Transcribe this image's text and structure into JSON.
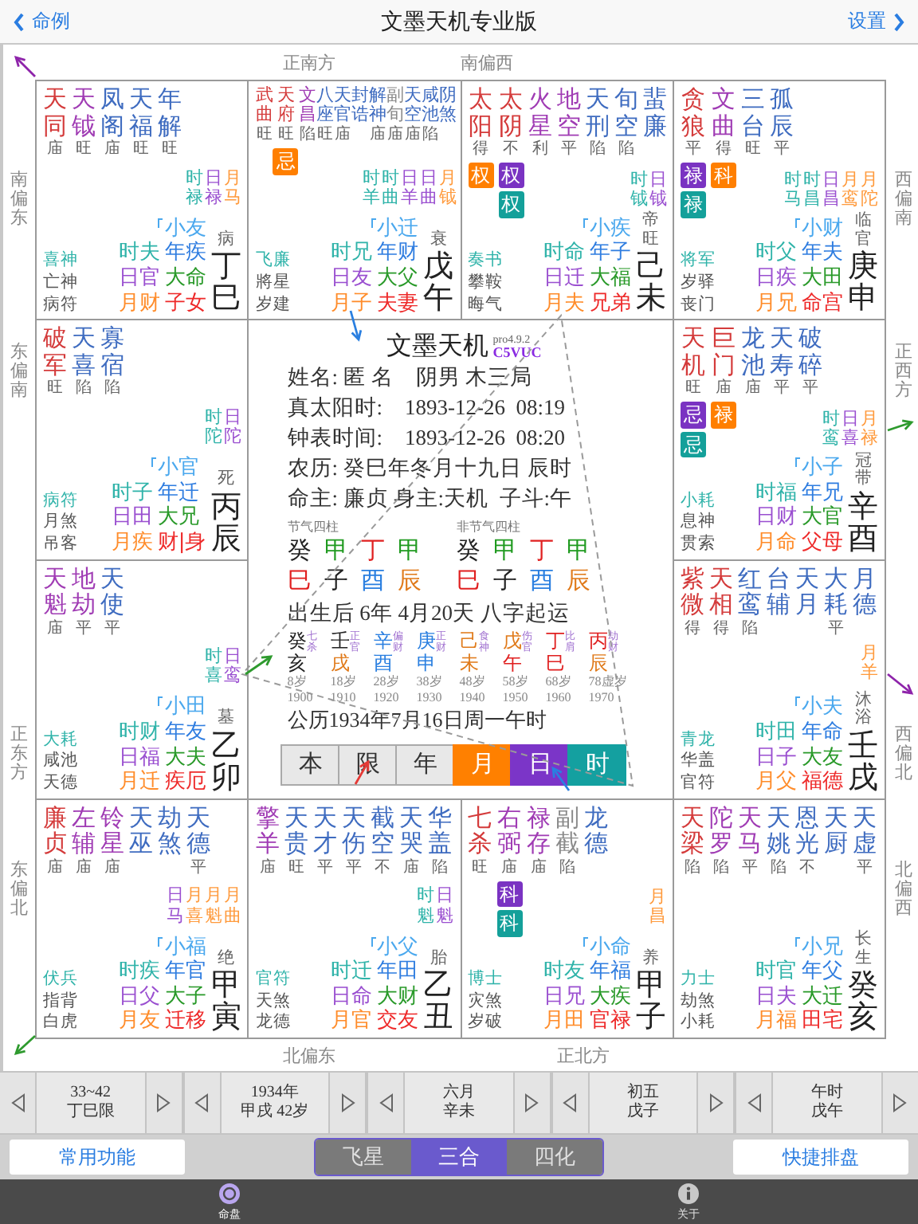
{
  "nav": {
    "back": "命例",
    "title": "文墨天机专业版",
    "settings": "设置"
  },
  "chart": {
    "directions": {
      "top": [
        "正南方",
        "南偏西"
      ],
      "left": [
        "南偏东",
        "东偏南",
        "正东方",
        "东偏北"
      ],
      "right": [
        "西偏南",
        "正西方",
        "西偏北",
        "北偏西"
      ],
      "bottom": [
        "北偏东",
        "正北方"
      ]
    },
    "palaces": [
      {
        "stars": [
          {
            "name": "天同",
            "brightness": "庙",
            "color": "#d43b3b"
          },
          {
            "name": "天钺",
            "brightness": "旺",
            "color": "#a03cb4"
          },
          {
            "name": "凤阁",
            "brightness": "庙",
            "color": "#3f6cc0"
          },
          {
            "name": "天福",
            "brightness": "旺",
            "color": "#3f6cc0"
          },
          {
            "name": "年解",
            "brightness": "旺",
            "color": "#3f6cc0"
          }
        ],
        "minor": [
          {
            "text": "时禄",
            "color": "#2fb3a9"
          },
          {
            "text": "日禄",
            "color": "#9a4fd0"
          },
          {
            "text": "月马",
            "color": "#ff9a3c"
          }
        ],
        "gods": [
          "喜神",
          "亡神",
          "病符"
        ],
        "times": [
          "时夫",
          "日官",
          "月财"
        ],
        "palaces": [
          "小友",
          "年疾",
          "大命",
          "子女"
        ],
        "stage": "病",
        "ganzhi": "丁巳"
      },
      {
        "stars": [
          {
            "name": "武曲",
            "brightness": "旺",
            "color": "#d43b3b"
          },
          {
            "name": "天府",
            "brightness": "旺",
            "color": "#d43b3b",
            "badges": [
              {
                "text": "忌",
                "color": "#ff7f00"
              }
            ]
          },
          {
            "name": "文昌",
            "brightness": "陷",
            "color": "#a03cb4"
          },
          {
            "name": "八座",
            "brightness": "旺",
            "color": "#3f6cc0"
          },
          {
            "name": "天官",
            "brightness": "庙",
            "color": "#3f6cc0"
          },
          {
            "name": "封诰",
            "color": "#3f6cc0"
          },
          {
            "name": "解神",
            "brightness": "庙",
            "color": "#3f6cc0"
          },
          {
            "name": "副旬",
            "brightness": "庙",
            "color": "#8a8a8a"
          },
          {
            "name": "天空",
            "brightness": "庙",
            "color": "#3f6cc0"
          },
          {
            "name": "咸池",
            "brightness": "陷",
            "color": "#3f6cc0"
          },
          {
            "name": "阴煞",
            "color": "#3f6cc0"
          }
        ],
        "minor": [
          {
            "text": "时羊",
            "color": "#2fb3a9"
          },
          {
            "text": "时曲",
            "color": "#2fb3a9"
          },
          {
            "text": "日羊",
            "color": "#9a4fd0"
          },
          {
            "text": "日曲",
            "color": "#9a4fd0"
          },
          {
            "text": "月钺",
            "color": "#ff9a3c"
          }
        ],
        "gods": [
          "飞廉",
          "將星",
          "岁建"
        ],
        "times": [
          "时兄",
          "日友",
          "月子"
        ],
        "palaces": [
          "小迁",
          "年财",
          "大父",
          "夫妻"
        ],
        "stage": "衰",
        "ganzhi": "戊午"
      },
      {
        "stars": [
          {
            "name": "太阳",
            "brightness": "得",
            "color": "#d43b3b",
            "badges": [
              {
                "text": "权",
                "color": "#ff7f00"
              }
            ]
          },
          {
            "name": "太阴",
            "brightness": "不",
            "color": "#d43b3b",
            "badges": [
              {
                "text": "权",
                "color": "#7a33c2"
              },
              {
                "text": "权",
                "color": "#14a09a"
              }
            ]
          },
          {
            "name": "火星",
            "brightness": "利",
            "color": "#a03cb4"
          },
          {
            "name": "地空",
            "brightness": "平",
            "color": "#a03cb4"
          },
          {
            "name": "天刑",
            "brightness": "陷",
            "color": "#3f6cc0"
          },
          {
            "name": "旬空",
            "brightness": "陷",
            "color": "#3f6cc0"
          },
          {
            "name": "蜚廉",
            "color": "#3f6cc0"
          }
        ],
        "minor": [
          {
            "text": "时钺",
            "color": "#2fb3a9"
          },
          {
            "text": "日钺",
            "color": "#9a4fd0"
          }
        ],
        "gods": [
          "奏书",
          "攀鞍",
          "晦气"
        ],
        "times": [
          "时命",
          "日迁",
          "月夫"
        ],
        "palaces": [
          "小疾",
          "年子",
          "大福",
          "兄弟"
        ],
        "stage": "帝旺",
        "ganzhi": "己未"
      },
      {
        "stars": [
          {
            "name": "贪狼",
            "brightness": "平",
            "color": "#d43b3b",
            "badges": [
              {
                "text": "禄",
                "color": "#7a33c2"
              },
              {
                "text": "禄",
                "color": "#14a09a"
              }
            ]
          },
          {
            "name": "文曲",
            "brightness": "得",
            "color": "#a03cb4",
            "badges": [
              {
                "text": "科",
                "color": "#ff7f00"
              }
            ]
          },
          {
            "name": "三台",
            "brightness": "旺",
            "color": "#3f6cc0"
          },
          {
            "name": "孤辰",
            "brightness": "平",
            "color": "#3f6cc0"
          }
        ],
        "minor": [
          {
            "text": "时马",
            "color": "#2fb3a9"
          },
          {
            "text": "时昌",
            "color": "#2fb3a9"
          },
          {
            "text": "日昌",
            "color": "#9a4fd0"
          },
          {
            "text": "月鸾",
            "color": "#ff9a3c"
          },
          {
            "text": "月陀",
            "color": "#ff9a3c"
          }
        ],
        "gods": [
          "将军",
          "岁驿",
          "丧门"
        ],
        "times": [
          "时父",
          "日疾",
          "月兄"
        ],
        "palaces": [
          "小财",
          "年夫",
          "大田",
          "命宫"
        ],
        "stage": "临官",
        "ganzhi": "庚申"
      },
      {
        "stars": [
          {
            "name": "破军",
            "brightness": "旺",
            "color": "#d43b3b"
          },
          {
            "name": "天喜",
            "brightness": "陷",
            "color": "#3f6cc0"
          },
          {
            "name": "寡宿",
            "brightness": "陷",
            "color": "#3f6cc0"
          }
        ],
        "minor": [
          {
            "text": "时陀",
            "color": "#2fb3a9"
          },
          {
            "text": "日陀",
            "color": "#9a4fd0"
          }
        ],
        "gods": [
          "病符",
          "月煞",
          "吊客"
        ],
        "times": [
          "时子",
          "日田",
          "月疾"
        ],
        "palaces": [
          "小官",
          "年迁",
          "大兄",
          "财|身"
        ],
        "stage": "死",
        "ganzhi": "丙辰"
      },
      {
        "stars": [
          {
            "name": "天机",
            "brightness": "旺",
            "color": "#d43b3b",
            "badges": [
              {
                "text": "忌",
                "color": "#7a33c2"
              },
              {
                "text": "忌",
                "color": "#14a09a"
              }
            ]
          },
          {
            "name": "巨门",
            "brightness": "庙",
            "color": "#d43b3b",
            "badges": [
              {
                "text": "禄",
                "color": "#ff7f00"
              }
            ]
          },
          {
            "name": "龙池",
            "brightness": "庙",
            "color": "#3f6cc0"
          },
          {
            "name": "天寿",
            "brightness": "平",
            "color": "#3f6cc0"
          },
          {
            "name": "破碎",
            "brightness": "平",
            "color": "#3f6cc0"
          }
        ],
        "minor": [
          {
            "text": "时鸾",
            "color": "#2fb3a9"
          },
          {
            "text": "日喜",
            "color": "#9a4fd0"
          },
          {
            "text": "月禄",
            "color": "#ff9a3c"
          }
        ],
        "gods": [
          "小耗",
          "息神",
          "贯索"
        ],
        "times": [
          "时福",
          "日财",
          "月命"
        ],
        "palaces": [
          "小子",
          "年兄",
          "大官",
          "父母"
        ],
        "stage": "冠带",
        "ganzhi": "辛酉"
      },
      {
        "stars": [
          {
            "name": "天魁",
            "brightness": "庙",
            "color": "#a03cb4"
          },
          {
            "name": "地劫",
            "brightness": "平",
            "color": "#a03cb4"
          },
          {
            "name": "天使",
            "brightness": "平",
            "color": "#3f6cc0"
          }
        ],
        "minor": [
          {
            "text": "时喜",
            "color": "#2fb3a9"
          },
          {
            "text": "日鸾",
            "color": "#9a4fd0"
          }
        ],
        "gods": [
          "大耗",
          "咸池",
          "天德"
        ],
        "times": [
          "时财",
          "日福",
          "月迁"
        ],
        "palaces": [
          "小田",
          "年友",
          "大夫",
          "疾厄"
        ],
        "stage": "墓",
        "ganzhi": "乙卯"
      },
      {
        "stars": [
          {
            "name": "紫微",
            "brightness": "得",
            "color": "#d43b3b"
          },
          {
            "name": "天相",
            "brightness": "得",
            "color": "#d43b3b"
          },
          {
            "name": "红鸾",
            "brightness": "陷",
            "color": "#3f6cc0"
          },
          {
            "name": "台辅",
            "color": "#3f6cc0"
          },
          {
            "name": "天月",
            "color": "#3f6cc0"
          },
          {
            "name": "大耗",
            "brightness": "平",
            "color": "#3f6cc0"
          },
          {
            "name": "月德",
            "color": "#3f6cc0"
          }
        ],
        "minor": [
          {
            "text": "月羊",
            "color": "#ff9a3c"
          }
        ],
        "gods": [
          "青龙",
          "华盖",
          "官符"
        ],
        "times": [
          "时田",
          "日子",
          "月父"
        ],
        "palaces": [
          "小夫",
          "年命",
          "大友",
          "福德"
        ],
        "stage": "沐浴",
        "ganzhi": "壬戌"
      },
      {
        "stars": [
          {
            "name": "廉贞",
            "brightness": "庙",
            "color": "#d43b3b"
          },
          {
            "name": "左辅",
            "brightness": "庙",
            "color": "#a03cb4"
          },
          {
            "name": "铃星",
            "brightness": "庙",
            "color": "#a03cb4"
          },
          {
            "name": "天巫",
            "color": "#3f6cc0"
          },
          {
            "name": "劫煞",
            "color": "#3f6cc0"
          },
          {
            "name": "天德",
            "brightness": "平",
            "color": "#3f6cc0"
          }
        ],
        "minor": [
          {
            "text": "日马",
            "color": "#9a4fd0"
          },
          {
            "text": "月喜",
            "color": "#ff9a3c"
          },
          {
            "text": "月魁",
            "color": "#ff9a3c"
          },
          {
            "text": "月曲",
            "color": "#ff9a3c"
          }
        ],
        "gods": [
          "伏兵",
          "指背",
          "白虎"
        ],
        "times": [
          "时疾",
          "日父",
          "月友"
        ],
        "palaces": [
          "小福",
          "年官",
          "大子",
          "迁移"
        ],
        "stage": "绝",
        "ganzhi": "甲寅"
      },
      {
        "stars": [
          {
            "name": "擎羊",
            "brightness": "庙",
            "color": "#a03cb4"
          },
          {
            "name": "天贵",
            "brightness": "旺",
            "color": "#3f6cc0"
          },
          {
            "name": "天才",
            "brightness": "平",
            "color": "#3f6cc0"
          },
          {
            "name": "天伤",
            "brightness": "平",
            "color": "#3f6cc0"
          },
          {
            "name": "截空",
            "brightness": "不",
            "color": "#3f6cc0"
          },
          {
            "name": "天哭",
            "brightness": "庙",
            "color": "#3f6cc0"
          },
          {
            "name": "华盖",
            "brightness": "陷",
            "color": "#3f6cc0"
          }
        ],
        "minor": [
          {
            "text": "时魁",
            "color": "#2fb3a9"
          },
          {
            "text": "日魁",
            "color": "#9a4fd0"
          }
        ],
        "gods": [
          "官符",
          "天煞",
          "龙德"
        ],
        "times": [
          "时迁",
          "日命",
          "月官"
        ],
        "palaces": [
          "小父",
          "年田",
          "大财",
          "交友"
        ],
        "stage": "胎",
        "ganzhi": "乙丑"
      },
      {
        "stars": [
          {
            "name": "七杀",
            "brightness": "旺",
            "color": "#d43b3b"
          },
          {
            "name": "右弼",
            "brightness": "庙",
            "color": "#a03cb4",
            "badges": [
              {
                "text": "科",
                "color": "#7a33c2"
              },
              {
                "text": "科",
                "color": "#14a09a"
              }
            ]
          },
          {
            "name": "禄存",
            "brightness": "庙",
            "color": "#a03cb4"
          },
          {
            "name": "副截",
            "brightness": "陷",
            "color": "#8a8a8a"
          },
          {
            "name": "龙德",
            "color": "#3f6cc0"
          }
        ],
        "minor": [
          {
            "text": "月昌",
            "color": "#ff9a3c"
          }
        ],
        "gods": [
          "博士",
          "灾煞",
          "岁破"
        ],
        "times": [
          "时友",
          "日兄",
          "月田"
        ],
        "palaces": [
          "小命",
          "年福",
          "大疾",
          "官禄"
        ],
        "stage": "养",
        "ganzhi": "甲子"
      },
      {
        "stars": [
          {
            "name": "天梁",
            "brightness": "陷",
            "color": "#d43b3b"
          },
          {
            "name": "陀罗",
            "brightness": "陷",
            "color": "#a03cb4"
          },
          {
            "name": "天马",
            "brightness": "平",
            "color": "#a03cb4"
          },
          {
            "name": "天姚",
            "brightness": "陷",
            "color": "#3f6cc0"
          },
          {
            "name": "恩光",
            "brightness": "不",
            "color": "#3f6cc0"
          },
          {
            "name": "天厨",
            "color": "#3f6cc0"
          },
          {
            "name": "天虚",
            "brightness": "平",
            "color": "#3f6cc0"
          }
        ],
        "gods": [
          "力士",
          "劫煞",
          "小耗"
        ],
        "times": [
          "时官",
          "日夫",
          "月福"
        ],
        "palaces": [
          "小兄",
          "年父",
          "大迁",
          "田宅"
        ],
        "stage": "长生",
        "ganzhi": "癸亥"
      }
    ],
    "center": {
      "title": "文墨天机",
      "version": "pro4.9.2",
      "code": "C5VUC",
      "info": [
        [
          "姓名: 匿 名",
          "阴男 木三局"
        ],
        [
          "真太阳时:",
          "1893-12-26  08:19"
        ],
        [
          "钟表时间:",
          "1893-12-26  08:20"
        ],
        [
          "农历: 癸巳年冬月十九日 辰时"
        ],
        [
          "命主: 廉贞 身主:天机  子斗:午"
        ]
      ],
      "pillars": [
        {
          "label": "节气四柱",
          "stems": [
            {
              "text": "癸",
              "color": "#222222"
            },
            {
              "text": "甲",
              "color": "#1f9a1f"
            },
            {
              "text": "丁",
              "color": "#e02020"
            },
            {
              "text": "甲",
              "color": "#1f9a1f"
            }
          ],
          "branches": [
            {
              "text": "巳",
              "color": "#e02020"
            },
            {
              "text": "子",
              "color": "#222222"
            },
            {
              "text": "酉",
              "color": "#2a7fe0"
            },
            {
              "text": "辰",
              "color": "#e07a1a"
            }
          ]
        },
        {
          "label": "非节气四柱",
          "stems": [
            {
              "text": "癸",
              "color": "#222222"
            },
            {
              "text": "甲",
              "color": "#1f9a1f"
            },
            {
              "text": "丁",
              "color": "#e02020"
            },
            {
              "text": "甲",
              "color": "#1f9a1f"
            }
          ],
          "branches": [
            {
              "text": "巳",
              "color": "#e02020"
            },
            {
              "text": "子",
              "color": "#222222"
            },
            {
              "text": "酉",
              "color": "#2a7fe0"
            },
            {
              "text": "辰",
              "color": "#e07a1a"
            }
          ]
        }
      ],
      "qiyun": "出生后 6年 4月20天 八字起运",
      "dayun": [
        {
          "stem": {
            "text": "癸",
            "color": "#222222"
          },
          "branch": {
            "text": "亥",
            "color": "#222222"
          },
          "ten_god": "七杀",
          "age": "8岁",
          "year": "1900"
        },
        {
          "stem": {
            "text": "壬",
            "color": "#222222"
          },
          "branch": {
            "text": "戌",
            "color": "#e07a1a"
          },
          "ten_god": "正官",
          "age": "18岁",
          "year": "1910"
        },
        {
          "stem": {
            "text": "辛",
            "color": "#2a7fe0"
          },
          "branch": {
            "text": "酉",
            "color": "#2a7fe0"
          },
          "ten_god": "偏财",
          "age": "28岁",
          "year": "1920"
        },
        {
          "stem": {
            "text": "庚",
            "color": "#2a7fe0"
          },
          "branch": {
            "text": "申",
            "color": "#2a7fe0"
          },
          "ten_god": "正财",
          "age": "38岁",
          "year": "1930"
        },
        {
          "stem": {
            "text": "己",
            "color": "#e07a1a"
          },
          "branch": {
            "text": "未",
            "color": "#e07a1a"
          },
          "ten_god": "食神",
          "age": "48岁",
          "year": "1940"
        },
        {
          "stem": {
            "text": "戊",
            "color": "#e07a1a"
          },
          "branch": {
            "text": "午",
            "color": "#e02020"
          },
          "ten_god": "伤官",
          "age": "58岁",
          "year": "1950"
        },
        {
          "stem": {
            "text": "丁",
            "color": "#e02020"
          },
          "branch": {
            "text": "巳",
            "color": "#e02020"
          },
          "ten_god": "比肩",
          "age": "68岁",
          "year": "1960"
        },
        {
          "stem": {
            "text": "丙",
            "color": "#e02020"
          },
          "branch": {
            "text": "辰",
            "color": "#e07a1a"
          },
          "ten_god": "劫财",
          "age": "78虚岁",
          "year": "1970"
        }
      ],
      "solar": "公历1934年7月16日周一午时",
      "scopes": [
        {
          "label": "本",
          "on": false
        },
        {
          "label": "限",
          "on": false
        },
        {
          "label": "年",
          "on": false
        },
        {
          "label": "月",
          "on": true,
          "color": "#ff8000"
        },
        {
          "label": "日",
          "on": true,
          "color": "#7b35c8"
        },
        {
          "label": "时",
          "on": true,
          "color": "#14a0a0"
        }
      ]
    }
  },
  "steppers": [
    {
      "lines": [
        "33~42",
        "丁巳限"
      ]
    },
    {
      "lines": [
        "1934年",
        "甲戌 42岁"
      ]
    },
    {
      "lines": [
        "六月",
        "辛未"
      ]
    },
    {
      "lines": [
        "初五",
        "戊子"
      ]
    },
    {
      "lines": [
        "午时",
        "戊午"
      ]
    }
  ],
  "actions": {
    "left": "常用功能",
    "modes": [
      {
        "label": "飞星",
        "selected": false
      },
      {
        "label": "三合",
        "selected": true
      },
      {
        "label": "四化",
        "selected": false
      }
    ],
    "right": "快捷排盘"
  },
  "tabbar": [
    {
      "label": "命盘",
      "selected": true
    },
    {
      "label": "关于",
      "selected": false
    }
  ]
}
